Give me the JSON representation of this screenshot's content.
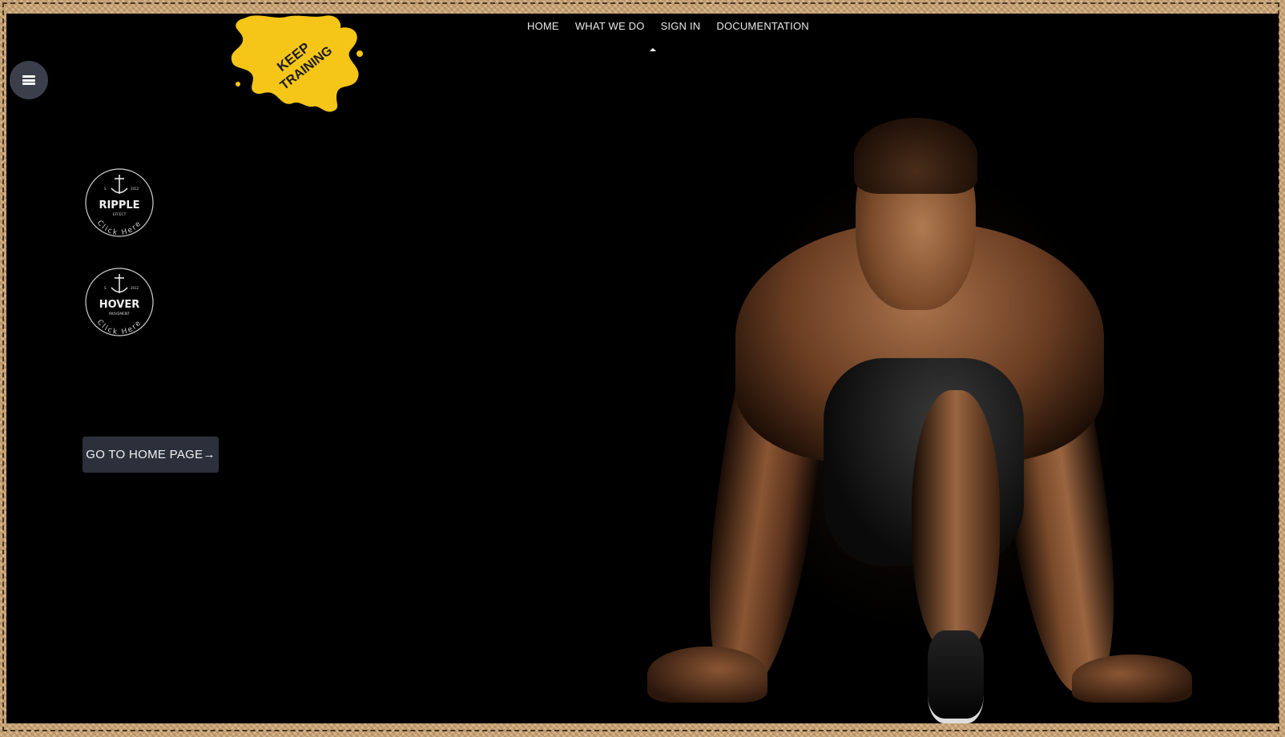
{
  "nav": {
    "items": [
      {
        "label": "HOME"
      },
      {
        "label": "WHAT WE DO"
      },
      {
        "label": "SIGN IN"
      },
      {
        "label": "DOCUMENTATION"
      }
    ]
  },
  "logo": {
    "line1": "KEEP",
    "line2": "TRAINING",
    "color": "#f5c518"
  },
  "badges": [
    {
      "title": "RIPPLE",
      "subtitle": "EFFECT",
      "est_left": "S.",
      "est_right": "2012",
      "ring_text": "Click Here",
      "icon": "anchor-icon"
    },
    {
      "title": "HOVER",
      "subtitle": "MOVEMENT",
      "est_left": "S.",
      "est_right": "2012",
      "ring_text": "Click Here",
      "icon": "anchor-icon"
    }
  ],
  "home_button": {
    "label": "GO TO HOME PAGE",
    "arrow": "→"
  },
  "menu_button": {
    "icon": "hamburger-menu-icon"
  },
  "colors": {
    "frame": "#c9a577",
    "stage": "#000000",
    "button_bg": "#2b303b",
    "menu_bg": "#3a3f4b",
    "logo_yellow": "#f5c518"
  }
}
